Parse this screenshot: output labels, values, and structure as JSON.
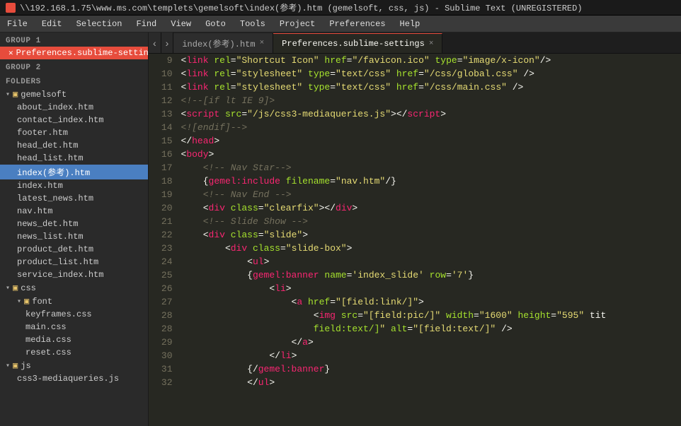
{
  "titlebar": {
    "icon": "sublime-icon",
    "text": "\\\\192.168.1.75\\www.ms.com\\templets\\gemelsoft\\index(参考).htm (gemelsoft, css, js) - Sublime Text (UNREGISTERED)"
  },
  "menubar": {
    "items": [
      "File",
      "Edit",
      "Selection",
      "Find",
      "View",
      "Goto",
      "Tools",
      "Project",
      "Preferences",
      "Help"
    ]
  },
  "sidebar": {
    "group1_label": "GROUP 1",
    "active_file": "Preferences.sublime-settings",
    "group2_label": "GROUP 2",
    "folders_label": "FOLDERS",
    "folders": [
      {
        "name": "gemelsoft",
        "type": "folder",
        "children": [
          "about_index.htm",
          "contact_index.htm",
          "footer.htm",
          "head_det.htm",
          "head_list.htm",
          "index(参考).htm",
          "index.htm",
          "latest_news.htm",
          "nav.htm",
          "news_det.htm",
          "news_list.htm",
          "product_det.htm",
          "product_list.htm",
          "service_index.htm"
        ]
      },
      {
        "name": "css",
        "type": "folder",
        "children": [
          {
            "name": "font",
            "type": "folder",
            "children": [
              "keyframes.css",
              "main.css",
              "media.css",
              "reset.css"
            ]
          }
        ]
      },
      {
        "name": "js",
        "type": "folder",
        "children": [
          "css3-mediaqueries.js"
        ]
      }
    ]
  },
  "tabs": {
    "nav_left": "‹",
    "nav_right": "›",
    "items": [
      {
        "label": "index(参考).htm",
        "active": false,
        "close": "×"
      },
      {
        "label": "Preferences.sublime-settings",
        "active": true,
        "close": "×"
      }
    ]
  },
  "code": {
    "lines": [
      {
        "num": 9,
        "html": "<span class='kw-punct'>&lt;</span><span class='kw-tag'>link</span> <span class='kw-attr'>rel</span><span class='kw-punct'>=</span><span class='kw-string'>\"Shortcut Icon\"</span> <span class='kw-attr'>href</span><span class='kw-punct'>=</span><span class='kw-string'>\"/favicon.ico\"</span> <span class='kw-attr'>type</span><span class='kw-punct'>=</span><span class='kw-string'>\"image/x-icon\"</span><span class='kw-punct'>/&gt;</span>"
      },
      {
        "num": 10,
        "html": "<span class='kw-punct'>&lt;</span><span class='kw-tag'>link</span> <span class='kw-attr'>rel</span><span class='kw-punct'>=</span><span class='kw-string'>\"stylesheet\"</span> <span class='kw-attr'>type</span><span class='kw-punct'>=</span><span class='kw-string'>\"text/css\"</span> <span class='kw-attr'>href</span><span class='kw-punct'>=</span><span class='kw-string'>\"/css/global.css\"</span> <span class='kw-punct'>/&gt;</span>"
      },
      {
        "num": 11,
        "html": "<span class='kw-punct'>&lt;</span><span class='kw-tag'>link</span> <span class='kw-attr'>rel</span><span class='kw-punct'>=</span><span class='kw-string'>\"stylesheet\"</span> <span class='kw-attr'>type</span><span class='kw-punct'>=</span><span class='kw-string'>\"text/css\"</span> <span class='kw-attr'>href</span><span class='kw-punct'>=</span><span class='kw-string'>\"/css/main.css\"</span> <span class='kw-punct'>/&gt;</span>"
      },
      {
        "num": 12,
        "html": "<span class='kw-comment'>&lt;!--[if lt IE 9]&gt;</span>"
      },
      {
        "num": 13,
        "html": "<span class='kw-punct'>&lt;</span><span class='kw-tag'>script</span> <span class='kw-attr'>src</span><span class='kw-punct'>=</span><span class='kw-string'>\"/js/css3-mediaqueries.js\"</span><span class='kw-punct'>&gt;&lt;/</span><span class='kw-tag'>script</span><span class='kw-punct'>&gt;</span>"
      },
      {
        "num": 14,
        "html": "<span class='kw-comment'>&lt;![endif]--&gt;</span>"
      },
      {
        "num": 15,
        "html": "<span class='kw-punct'>&lt;/</span><span class='kw-tag'>head</span><span class='kw-punct'>&gt;</span>"
      },
      {
        "num": 16,
        "html": "<span class='kw-punct'>&lt;</span><span class='kw-tag'>body</span><span class='kw-punct'>&gt;</span>"
      },
      {
        "num": 17,
        "html": "    <span class='kw-comment'>&lt;!-- Nav Star--&gt;</span>"
      },
      {
        "num": 18,
        "html": "    <span class='kw-punct'>{</span><span class='kw-tag'>gemel:include</span> <span class='kw-attr'>filename</span><span class='kw-punct'>=</span><span class='kw-string'>\"nav.htm\"</span><span class='kw-punct'>/}</span>"
      },
      {
        "num": 19,
        "html": "    <span class='kw-comment'>&lt;!-- Nav End --&gt;</span>"
      },
      {
        "num": 20,
        "html": "    <span class='kw-punct'>&lt;</span><span class='kw-tag'>div</span> <span class='kw-attr'>class</span><span class='kw-punct'>=</span><span class='kw-string'>\"clearfix\"</span><span class='kw-punct'>&gt;&lt;/</span><span class='kw-tag'>div</span><span class='kw-punct'>&gt;</span>"
      },
      {
        "num": 21,
        "html": "    <span class='kw-comment'>&lt;!-- Slide Show --&gt;</span>"
      },
      {
        "num": 22,
        "html": "    <span class='kw-punct'>&lt;</span><span class='kw-tag'>div</span> <span class='kw-attr'>class</span><span class='kw-punct'>=</span><span class='kw-string'>\"slide\"</span><span class='kw-punct'>&gt;</span>"
      },
      {
        "num": 23,
        "html": "        <span class='kw-punct'>&lt;</span><span class='kw-tag'>div</span> <span class='kw-attr'>class</span><span class='kw-punct'>=</span><span class='kw-string'>\"slide-box\"</span><span class='kw-punct'>&gt;</span>"
      },
      {
        "num": 24,
        "html": "            <span class='kw-punct'>&lt;</span><span class='kw-tag'>ul</span><span class='kw-punct'>&gt;</span>"
      },
      {
        "num": 25,
        "html": "            <span class='kw-punct'>{</span><span class='kw-tag'>gemel:banner</span> <span class='kw-attr'>name</span><span class='kw-punct'>=</span><span class='kw-string'>'index_slide'</span> <span class='kw-attr'>row</span><span class='kw-punct'>=</span><span class='kw-string'>'7'</span><span class='kw-punct'>}</span>"
      },
      {
        "num": 26,
        "html": "                <span class='kw-punct'>&lt;</span><span class='kw-tag'>li</span><span class='kw-punct'>&gt;</span>"
      },
      {
        "num": 27,
        "html": "                    <span class='kw-punct'>&lt;</span><span class='kw-tag'>a</span> <span class='kw-attr'>href</span><span class='kw-punct'>=</span><span class='kw-string'>\"[field:link/]\"</span><span class='kw-punct'>&gt;</span>"
      },
      {
        "num": 28,
        "html": "                        <span class='kw-punct'>&lt;</span><span class='kw-tag'>img</span> <span class='kw-attr'>src</span><span class='kw-punct'>=</span><span class='kw-string'>\"[field:pic/]\"</span> <span class='kw-attr'>width</span><span class='kw-punct'>=</span><span class='kw-string'>\"1600\"</span> <span class='kw-attr'>height</span><span class='kw-punct'>=</span><span class='kw-string'>\"595\"</span> <span class='kw-text'>tit</span>"
      },
      {
        "num": 28,
        "html": "                        <span class='kw-attr'>field:text/]</span><span class='kw-string'>\"</span> <span class='kw-attr'>alt</span><span class='kw-punct'>=</span><span class='kw-string'>\"[field:text/]\"</span> <span class='kw-punct'>/&gt;</span>"
      },
      {
        "num": 29,
        "html": "                    <span class='kw-punct'>&lt;/</span><span class='kw-tag'>a</span><span class='kw-punct'>&gt;</span>"
      },
      {
        "num": 30,
        "html": "                <span class='kw-punct'>&lt;/</span><span class='kw-tag'>li</span><span class='kw-punct'>&gt;</span>"
      },
      {
        "num": 31,
        "html": "            <span class='kw-punct'>{/</span><span class='kw-tag'>gemel:banner</span><span class='kw-punct'>}</span>"
      },
      {
        "num": 32,
        "html": "            <span class='kw-punct'>&lt;/</span><span class='kw-tag'>ul</span><span class='kw-punct'>&gt;</span>"
      }
    ]
  }
}
